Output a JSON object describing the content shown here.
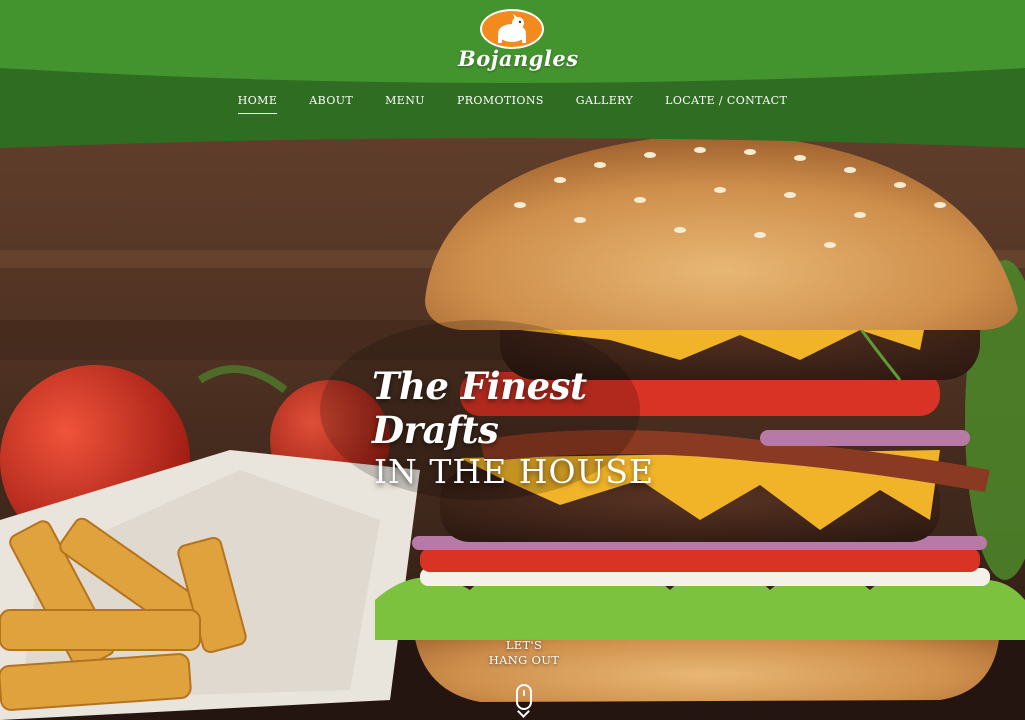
{
  "brand": {
    "name": "Bojangles",
    "logo_icon": "dog-mascot-badge",
    "colors": {
      "header_green": "#3f8f2b",
      "nav_green": "#2f6e22",
      "badge_orange": "#f28a1e"
    }
  },
  "nav": {
    "items": [
      {
        "label": "HOME",
        "active": true
      },
      {
        "label": "ABOUT",
        "active": false
      },
      {
        "label": "MENU",
        "active": false
      },
      {
        "label": "PROMOTIONS",
        "active": false
      },
      {
        "label": "GALLERY",
        "active": false
      },
      {
        "label": "LOCATE / CONTACT",
        "active": false
      }
    ]
  },
  "hero": {
    "headline_script": "The Finest Drafts",
    "headline_caps": "IN THE HOUSE",
    "image": "burger-fries-tomatoes-photo"
  },
  "scroll_prompt": {
    "line1": "LET'S",
    "line2": "HANG OUT",
    "icon": "mouse-scroll-icon"
  }
}
